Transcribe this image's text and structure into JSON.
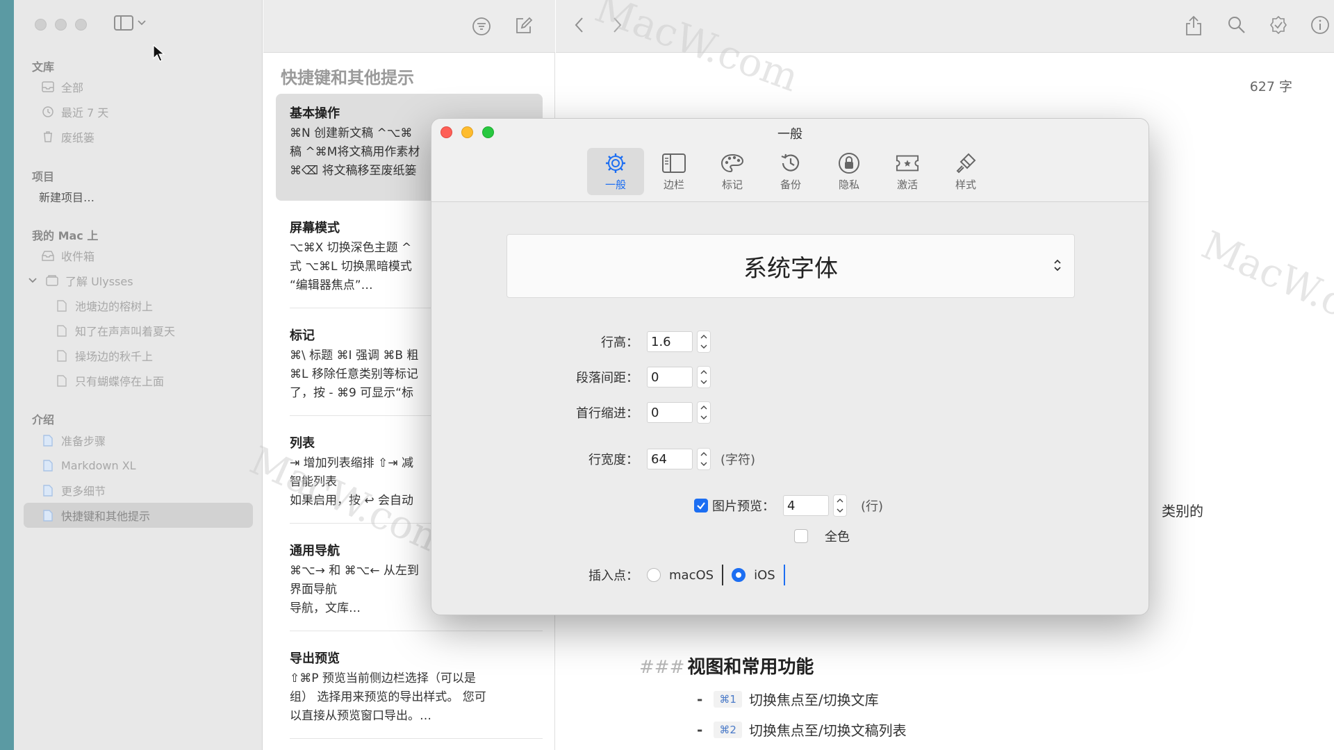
{
  "sidebar": {
    "sections": {
      "library": "文库",
      "projects": "项目",
      "my_mac": "我的 Mac 上",
      "intro": "介绍"
    },
    "library_items": [
      {
        "label": "全部",
        "icon": "inbox-icon"
      },
      {
        "label": "最近 7 天",
        "icon": "clock-icon"
      },
      {
        "label": "废纸篓",
        "icon": "trash-icon"
      }
    ],
    "new_project": "新建项目…",
    "inbox": "收件箱",
    "group": "了解 Ulysses",
    "group_items": [
      "池塘边的榕树上",
      "知了在声声叫着夏天",
      "操场边的秋千上",
      "只有蝴蝶停在上面"
    ],
    "intro_items": [
      "准备步骤",
      "Markdown XL",
      "更多细节",
      "快捷键和其他提示"
    ]
  },
  "sheet_list": {
    "title": "快捷键和其他提示",
    "sheets": [
      {
        "title": "基本操作",
        "body": "⌘N 创建新文稿 ^⌥⌘\n稿 ^⌘M将文稿用作素材\n⌘⌫ 将文稿移至废纸篓"
      },
      {
        "title": "屏幕模式",
        "body": "⌥⌘X 切换深色主题 ^\n式 ⌥⌘L 切换黑暗模式\n“编辑器焦点”…"
      },
      {
        "title": "标记",
        "body": "⌘\\ 标题 ⌘I 强调 ⌘B 粗\n⌘L 移除任意类别等标记\n了，按 - ⌘9 可显示“标"
      },
      {
        "title": "列表",
        "body": "⇥ 增加列表缩排 ⇧⇥ 减\n智能列表\n如果启用，按 ↩ 会自动"
      },
      {
        "title": "通用导航",
        "body": "⌘⌥→ 和 ⌘⌥← 从左到\n界面导航\n导航，文库…"
      },
      {
        "title": "导出预览",
        "body": "⇧⌘P 预览当前侧边栏选择（可以是\n组） 选择用来预览的导出样式。 您可\n以直接从预览窗口导出。…"
      }
    ]
  },
  "editor": {
    "word_count": "627 字",
    "fragment": "类别的",
    "heading_hash": "###",
    "heading": "视图和常用功能",
    "lines": [
      {
        "kbd": "⌘1",
        "text": "切换焦点至/切换文库"
      },
      {
        "kbd": "⌘2",
        "text": "切换焦点至/切换文稿列表"
      }
    ],
    "watermark": "MacW.com"
  },
  "prefs": {
    "title": "一般",
    "tabs": [
      {
        "label": "一般",
        "icon": "gear-icon"
      },
      {
        "label": "边栏",
        "icon": "sidebar-icon"
      },
      {
        "label": "标记",
        "icon": "palette-icon"
      },
      {
        "label": "备份",
        "icon": "history-clock-icon"
      },
      {
        "label": "隐私",
        "icon": "lock-icon"
      },
      {
        "label": "激活",
        "icon": "ticket-icon"
      },
      {
        "label": "样式",
        "icon": "brush-icon"
      }
    ],
    "font": "系统字体",
    "line_height_label": "行高：",
    "line_height": "1.6",
    "para_spacing_label": "段落间距：",
    "para_spacing": "0",
    "first_indent_label": "首行缩进：",
    "first_indent": "0",
    "line_width_label": "行宽度：",
    "line_width": "64",
    "line_width_unit": "(字符)",
    "image_preview_label": "图片预览：",
    "image_preview": "4",
    "image_preview_unit": "(行)",
    "full_color_label": "全色",
    "insertion_label": "插入点：",
    "insertion_options": [
      "macOS",
      "iOS"
    ],
    "colors": {
      "accent": "#1c6ef2",
      "close": "#fe5f57",
      "minimize": "#febc2e",
      "zoom": "#28c840"
    }
  }
}
